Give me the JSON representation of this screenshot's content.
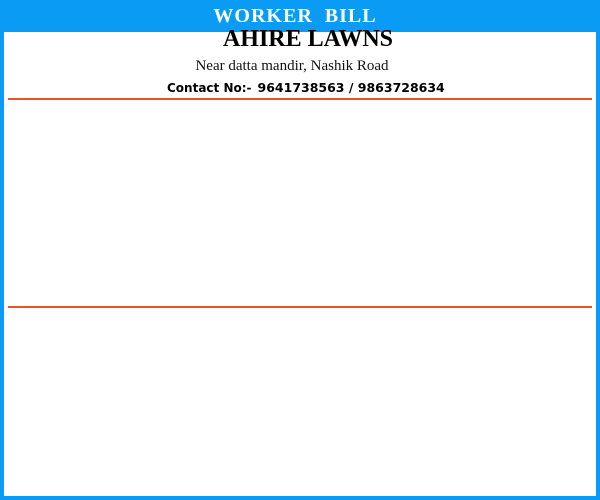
{
  "window": {
    "title": "WORKER  BILL"
  },
  "business": {
    "name": "AHIRE LAWNS",
    "address": "Near datta mandir, Nashik Road",
    "contact_label": "Contact No:-",
    "contact_numbers": "9641738563 / 9863728634"
  },
  "colors": {
    "title_bar": "#0a9cf5",
    "border": "#0a9cf5",
    "divider": "#e0572b"
  }
}
